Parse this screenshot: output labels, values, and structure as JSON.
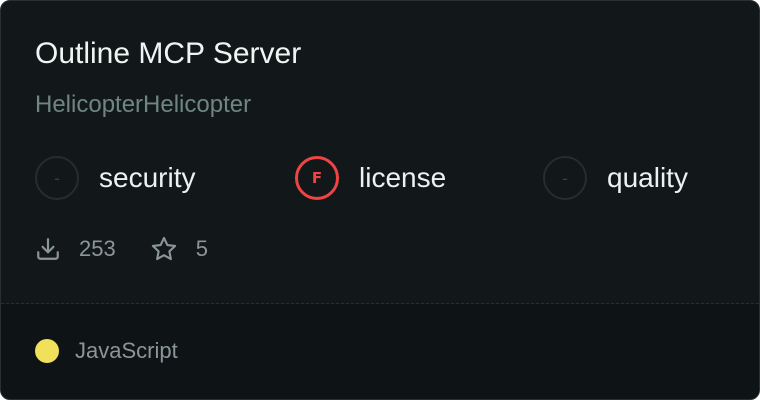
{
  "card": {
    "title": "Outline MCP Server",
    "owner": "HelicopterHelicopter",
    "scores": [
      {
        "label": "security",
        "grade": "-",
        "status": "none"
      },
      {
        "label": "license",
        "grade": "F",
        "status": "fail"
      },
      {
        "label": "quality",
        "grade": "-",
        "status": "none"
      }
    ],
    "stats": {
      "downloads": "253",
      "downloads_icon": "download-icon",
      "stars": "5",
      "stars_icon": "star-icon"
    },
    "language": {
      "name": "JavaScript",
      "color": "#f1e05a"
    }
  },
  "colors": {
    "card_background": "#121819",
    "footer_background": "#0e1315",
    "fail_red": "#ef4444",
    "owner_text": "#6f8580"
  }
}
